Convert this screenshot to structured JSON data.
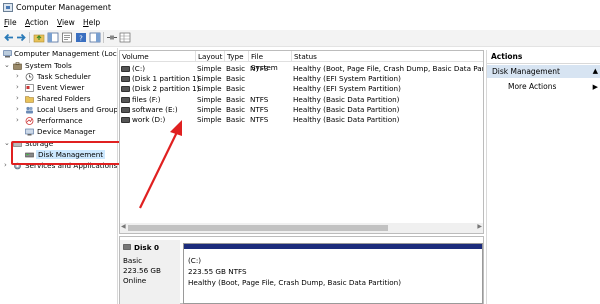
{
  "window": {
    "title": "Computer Management"
  },
  "menu": [
    {
      "label": "File",
      "u": "F",
      "rest": "ile"
    },
    {
      "label": "Action",
      "u": "A",
      "rest": "ction"
    },
    {
      "label": "View",
      "u": "V",
      "rest": "iew"
    },
    {
      "label": "Help",
      "u": "H",
      "rest": "elp"
    }
  ],
  "tree": {
    "root": "Computer Management (Local",
    "system_tools": "System Tools",
    "task_scheduler": "Task Scheduler",
    "event_viewer": "Event Viewer",
    "shared_folders": "Shared Folders",
    "local_users": "Local Users and Groups",
    "performance": "Performance",
    "device_manager": "Device Manager",
    "storage": "Storage",
    "disk_management": "Disk Management",
    "services": "Services and Applications"
  },
  "volumes": {
    "columns": [
      "Volume",
      "Layout",
      "Type",
      "File System",
      "Status"
    ],
    "rows": [
      {
        "volume": "(C:)",
        "layout": "Simple",
        "type": "Basic",
        "fs": "NTFS",
        "status": "Healthy (Boot, Page File, Crash Dump, Basic Data Partition)"
      },
      {
        "volume": "(Disk 1 partition 1)",
        "layout": "Simple",
        "type": "Basic",
        "fs": "",
        "status": "Healthy (EFI System Partition)"
      },
      {
        "volume": "(Disk 2 partition 1)",
        "layout": "Simple",
        "type": "Basic",
        "fs": "",
        "status": "Healthy (EFI System Partition)"
      },
      {
        "volume": "files (F:)",
        "layout": "Simple",
        "type": "Basic",
        "fs": "NTFS",
        "status": "Healthy (Basic Data Partition)"
      },
      {
        "volume": "software (E:)",
        "layout": "Simple",
        "type": "Basic",
        "fs": "NTFS",
        "status": "Healthy (Basic Data Partition)"
      },
      {
        "volume": "work (D:)",
        "layout": "Simple",
        "type": "Basic",
        "fs": "NTFS",
        "status": "Healthy (Basic Data Partition)"
      }
    ]
  },
  "disk": {
    "name": "Disk 0",
    "type": "Basic",
    "size": "223.56 GB",
    "state": "Online",
    "partition_name": "(C:)",
    "partition_size": "223.55 GB NTFS",
    "partition_status": "Healthy (Boot, Page File, Crash Dump, Basic Data Partition)"
  },
  "actions": {
    "header": "Actions",
    "section": "Disk Management",
    "more": "More Actions"
  },
  "colors": {
    "selection": "#cce8ff",
    "highlight_box": "#e02020",
    "arrow": "#e02020",
    "partition_bar": "#1c2c7c",
    "actions_section": "#d7e4f2"
  }
}
